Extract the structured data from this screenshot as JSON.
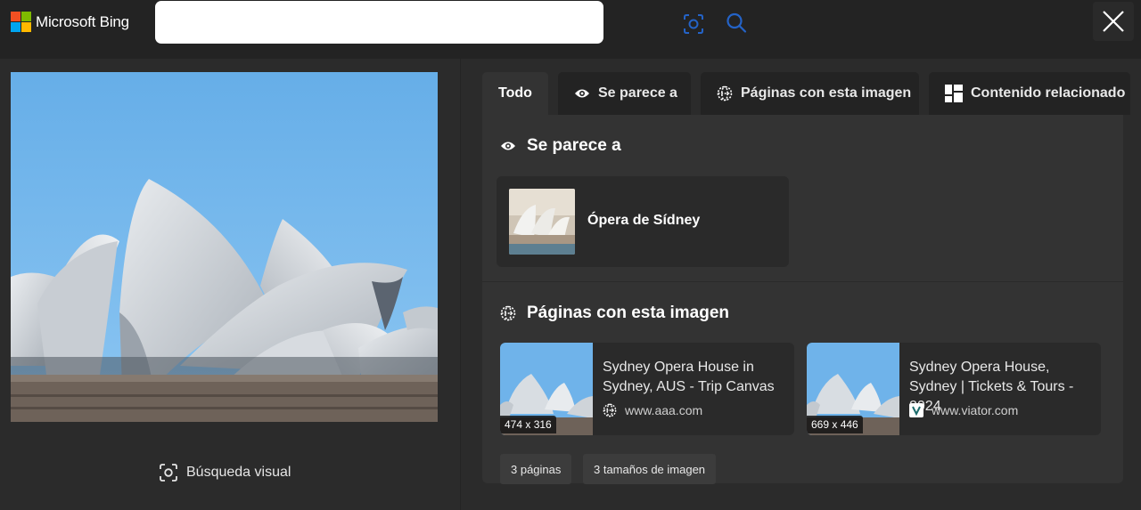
{
  "header": {
    "logo_text": "Microsoft Bing",
    "search": {
      "value": "",
      "placeholder": ""
    },
    "logo_colors": [
      "#f25022",
      "#7fba00",
      "#00a4ef",
      "#ffb900"
    ]
  },
  "left_pane": {
    "visual_search_label": "Búsqueda visual"
  },
  "tabs": [
    {
      "label": "Todo",
      "icon": ""
    },
    {
      "label": "Se parece a",
      "icon": "eye-icon"
    },
    {
      "label": "Páginas con esta imagen",
      "icon": "globe-icon"
    },
    {
      "label": "Contenido relacionado",
      "icon": "grid-icon"
    }
  ],
  "similar_section": {
    "title": "Se parece a",
    "item": {
      "label": "Ópera de Sídney"
    }
  },
  "pages_section": {
    "title": "Páginas con esta imagen",
    "items": [
      {
        "title": "Sydney Opera House in Sydney, AUS - Trip Canvas",
        "size": "474 x 316",
        "source": "www.aaa.com",
        "source_icon": "globe-icon"
      },
      {
        "title": "Sydney Opera House, Sydney | Tickets & Tours - 2024",
        "size": "669 x 446",
        "source": "www.viator.com",
        "source_icon": "viator-icon"
      }
    ],
    "chips": [
      "3 páginas",
      "3 tamaños de imagen"
    ]
  },
  "colors": {
    "sky": "#6fb3ea",
    "shell": "#d9dde2",
    "header_bg": "#232323",
    "panel_bg": "#333333"
  }
}
